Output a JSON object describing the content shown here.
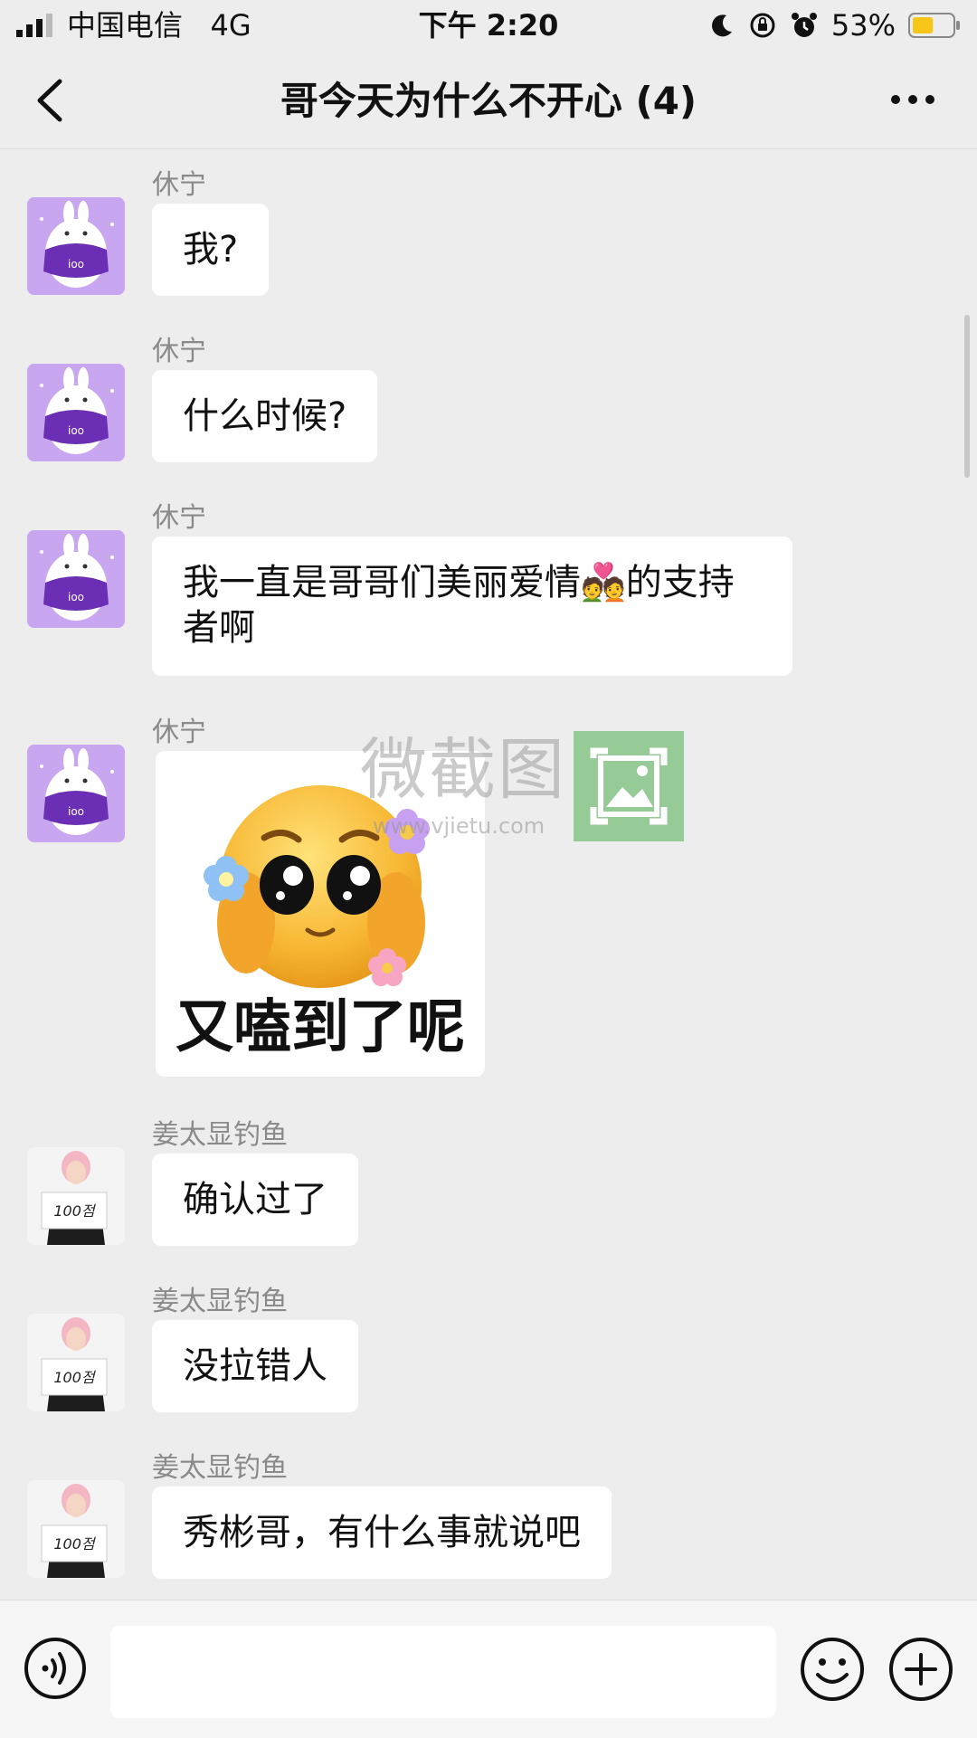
{
  "status_bar": {
    "carrier": "中国电信",
    "network": "4G",
    "time": "下午 2:20",
    "battery_percent": "53%",
    "battery_level": 0.53,
    "battery_color": "#f5c518"
  },
  "nav": {
    "title": "哥今天为什么不开心 (4)"
  },
  "messages": [
    {
      "sender": "休宁",
      "text": "我?",
      "avatar": "bunny-avatar"
    },
    {
      "sender": "休宁",
      "text": "什么时候?",
      "avatar": "bunny-avatar"
    },
    {
      "sender": "休宁",
      "text": "我一直是哥哥们美丽爱情💑的支持者啊",
      "avatar": "bunny-avatar"
    },
    {
      "sender": "休宁",
      "sticker_caption": "又嗑到了呢",
      "sticker": "pleading-face-sticker",
      "avatar": "bunny-avatar"
    },
    {
      "sender": "姜太显钓鱼",
      "text": "确认过了",
      "avatar": "person-sign-avatar",
      "avatar_sign": "100점"
    },
    {
      "sender": "姜太显钓鱼",
      "text": "没拉错人",
      "avatar": "person-sign-avatar",
      "avatar_sign": "100점"
    },
    {
      "sender": "姜太显钓鱼",
      "text": "秀彬哥，有什么事就说吧",
      "avatar": "person-sign-avatar",
      "avatar_sign": "100점"
    }
  ],
  "watermark": {
    "text": "微截图",
    "url": "www.vjietu.com"
  },
  "input_bar": {
    "value": "",
    "voice_icon": "voice-icon",
    "emoji_icon": "emoji-icon",
    "plus_icon": "plus-icon"
  },
  "colors": {
    "background": "#ededed",
    "bubble": "#ffffff",
    "sender_name": "#8a8a8a",
    "bunny_avatar_bg": "#c9a6f0",
    "scarf_purple": "#6a2fb5"
  }
}
